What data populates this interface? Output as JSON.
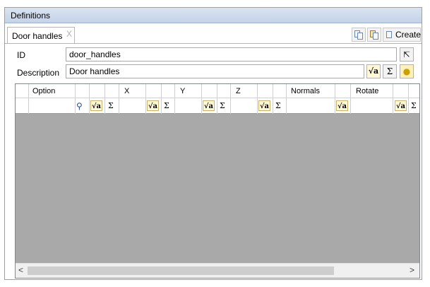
{
  "panel": {
    "title": "Definitions"
  },
  "tab": {
    "label": "Door handles",
    "close_glyph": "X"
  },
  "toolbar": {
    "create_label": "Create",
    "icons": [
      "copy-icon",
      "paste-icon",
      "new-document-icon"
    ]
  },
  "form": {
    "id_label": "ID",
    "id_value": "door_handles",
    "description_label": "Description",
    "description_value": "Door handles"
  },
  "buttons": {
    "sqrt": "√a",
    "sigma": "Σ"
  },
  "grid": {
    "columns": [
      "Option",
      "X",
      "Y",
      "Z",
      "Normals",
      "Rotate"
    ]
  },
  "scroll": {
    "left": "<",
    "right": ">"
  }
}
